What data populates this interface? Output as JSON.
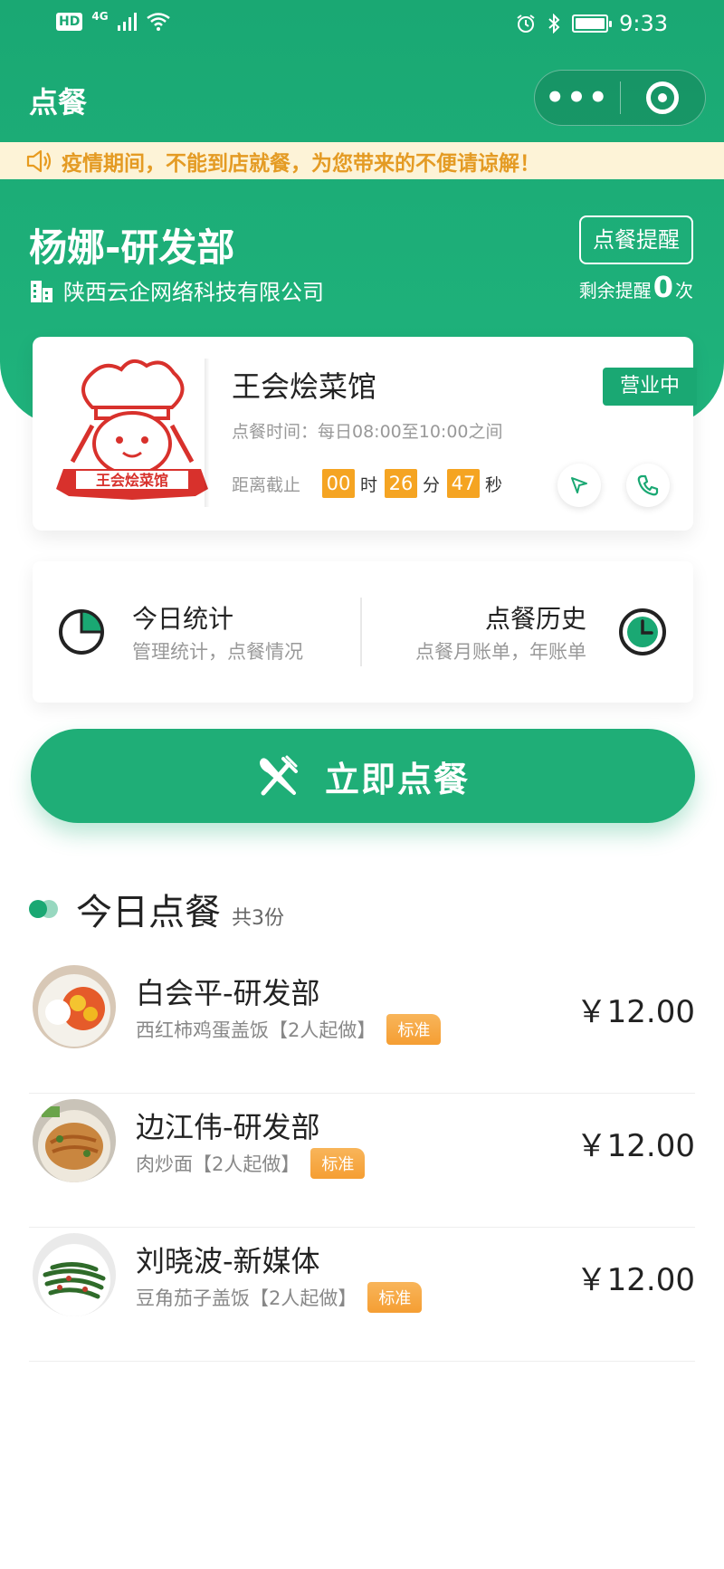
{
  "status": {
    "left_badges": [
      "HD",
      "4G"
    ],
    "time": "9:33"
  },
  "nav": {
    "title": "点餐",
    "more_icon": "more-dots-icon",
    "target_icon": "record-target-icon"
  },
  "notice": {
    "icon": "speaker-icon",
    "text": "疫情期间，不能到店就餐，为您带来的不便请谅解！"
  },
  "user": {
    "name": "杨娜-研发部",
    "company": "陕西云企网络科技有限公司",
    "remind_button": "点餐提醒",
    "remind_prefix": "剩余提醒",
    "remind_count": "0",
    "remind_suffix": "次"
  },
  "store": {
    "name": "王会烩菜馆",
    "status": "营业中",
    "hours": "点餐时间：每日08:00至10:00之间",
    "countdown_label": "距离截止",
    "hours_left": "00",
    "hours_unit": "时",
    "minutes_left": "26",
    "minutes_unit": "分",
    "seconds_left": "47",
    "seconds_unit": "秒",
    "logo_text": "王会烩菜馆"
  },
  "stats": {
    "left_title": "今日统计",
    "left_sub": "管理统计，点餐情况",
    "right_title": "点餐历史",
    "right_sub": "点餐月账单，年账单"
  },
  "order_button": {
    "label": "立即点餐"
  },
  "today": {
    "title": "今日点餐",
    "count": "共3份",
    "orders": [
      {
        "name": "白会平-研发部",
        "dish": "西红柿鸡蛋盖饭【2人起做】",
        "tag": "标准",
        "price": "￥12.00"
      },
      {
        "name": "边江伟-研发部",
        "dish": "肉炒面【2人起做】",
        "tag": "标准",
        "price": "￥12.00"
      },
      {
        "name": "刘晓波-新媒体",
        "dish": "豆角茄子盖饭【2人起做】",
        "tag": "标准",
        "price": "￥12.00"
      }
    ]
  },
  "colors": {
    "brand_green": "#1aa873",
    "warning_orange": "#f5a422",
    "notice_bg": "#fdf3d7"
  }
}
